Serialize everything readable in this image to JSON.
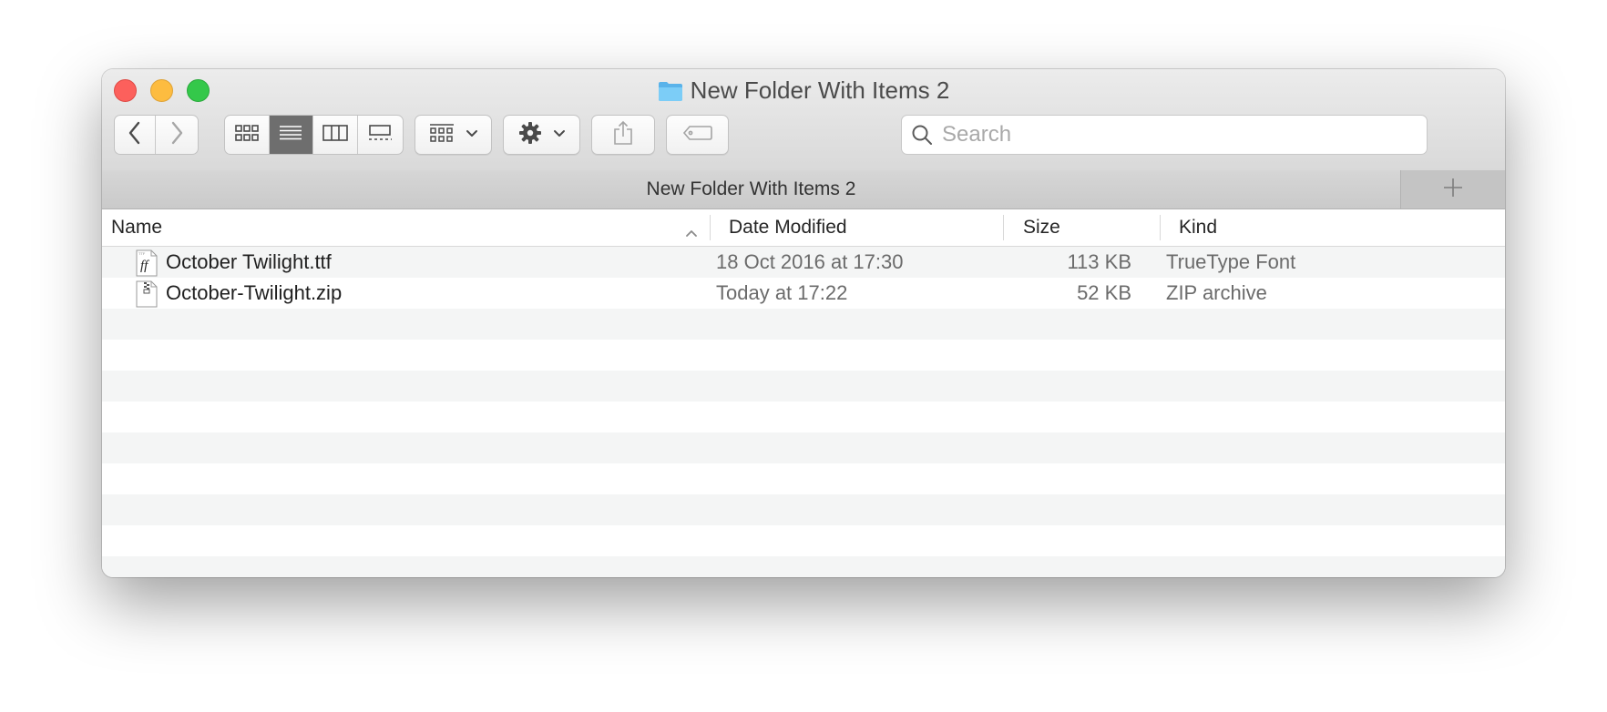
{
  "window": {
    "title": "New Folder With Items 2"
  },
  "toolbar": {
    "back_icon": "chevron-left-icon",
    "forward_icon": "chevron-right-icon",
    "view_modes": [
      "icon-view-icon",
      "list-view-icon",
      "column-view-icon",
      "gallery-view-icon"
    ],
    "active_view": "list",
    "group_icon": "group-by-icon",
    "action_icon": "gear-icon",
    "share_icon": "share-icon",
    "tag_icon": "tag-icon",
    "search_placeholder": "Search"
  },
  "tab": {
    "label": "New Folder With Items 2",
    "add_icon": "plus-icon"
  },
  "columns": {
    "name": "Name",
    "date": "Date Modified",
    "size": "Size",
    "kind": "Kind"
  },
  "files": [
    {
      "name": "October Twilight.ttf",
      "date": "18 Oct 2016 at 17:30",
      "size": "113 KB",
      "kind": "TrueType Font",
      "icon": "font-file-icon"
    },
    {
      "name": "October-Twilight.zip",
      "date": "Today at 17:22",
      "size": "52 KB",
      "kind": "ZIP archive",
      "icon": "zip-file-icon"
    }
  ],
  "colors": {
    "close": "#fc605c",
    "minimize": "#fdbc40",
    "maximize": "#34c84a",
    "folder": "#6cc4f4",
    "active_segment": "#6e6e6e",
    "row_alt": "#f4f5f5"
  }
}
